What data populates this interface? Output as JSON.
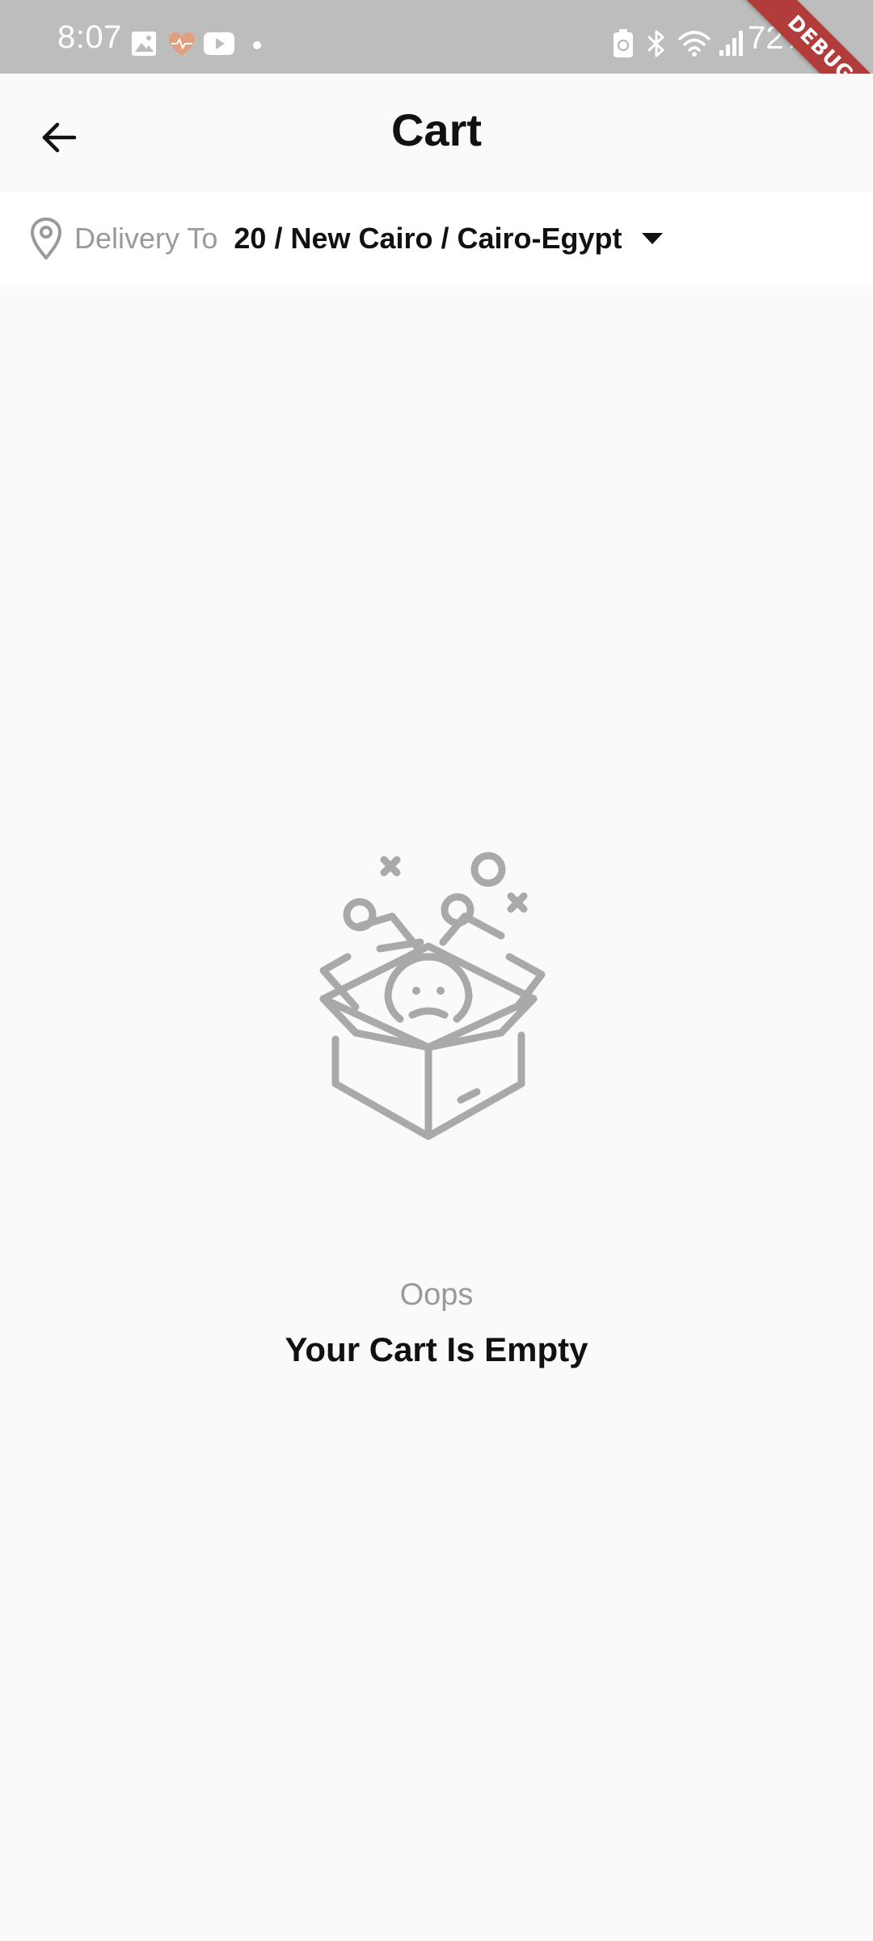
{
  "status_bar": {
    "time": "8:07",
    "battery": "72%",
    "debug_banner": "DEBUG",
    "icons": [
      "gallery-icon",
      "heart-app-icon",
      "youtube-icon",
      "dot-icon",
      "battery-saver-icon",
      "bluetooth-icon",
      "wifi-icon",
      "signal-icon"
    ]
  },
  "app_bar": {
    "title": "Cart",
    "back_icon": "arrow-left-icon"
  },
  "delivery": {
    "label": "Delivery To",
    "address": "20 / New Cairo / Cairo-Egypt",
    "pin_icon": "location-pin-icon",
    "dropdown_icon": "caret-down-icon"
  },
  "empty_state": {
    "illustration": "empty-box-icon",
    "subtitle": "Oops",
    "title": "Your Cart Is Empty"
  },
  "colors": {
    "status_bar_bg": "#bdbdbd",
    "page_bg": "#fafafa",
    "muted_text": "#9a9a9a",
    "illustration": "#a9a9a9",
    "debug_ribbon": "#b23b3b"
  }
}
